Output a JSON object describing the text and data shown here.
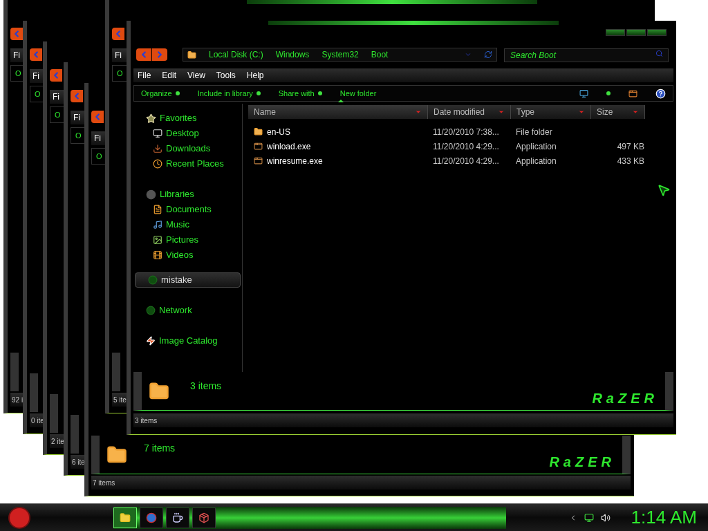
{
  "desktop_windows": [
    {
      "menu_fragment": "Fi",
      "toolbar_fragment": "O",
      "status": "92 i"
    },
    {
      "menu_fragment": "Fi",
      "toolbar_fragment": "O",
      "status": "0 ite"
    },
    {
      "menu_fragment": "Fi",
      "toolbar_fragment": "O",
      "status": "2 ite"
    },
    {
      "menu_fragment": "Fi",
      "toolbar_fragment": "O",
      "status": "6 ite"
    },
    {
      "menu_fragment": "Fi",
      "toolbar_fragment": "O",
      "status": "7 items",
      "details": "7 items",
      "logo": "RaZER"
    },
    {
      "menu_fragment": "Fi",
      "toolbar_fragment": "O",
      "status": "5 ite"
    }
  ],
  "main_window": {
    "address": [
      "Local Disk (C:)",
      "Windows",
      "System32",
      "Boot"
    ],
    "search": {
      "placeholder": "Search Boot"
    },
    "menu": [
      "File",
      "Edit",
      "View",
      "Tools",
      "Help"
    ],
    "toolbar": [
      {
        "label": "Organize",
        "dropdown": true
      },
      {
        "label": "Include in library",
        "dropdown": true
      },
      {
        "label": "Share with",
        "dropdown": true
      },
      {
        "label": "New folder",
        "dropdown": false
      }
    ],
    "columns": [
      {
        "label": "Name",
        "sorted": true
      },
      {
        "label": "Date modified",
        "sorted": false
      },
      {
        "label": "Type",
        "sorted": false
      },
      {
        "label": "Size",
        "sorted": false
      }
    ],
    "rows": [
      {
        "kind": "folder",
        "name": "en-US",
        "date": "11/20/2010 7:38...",
        "type": "File folder"
      },
      {
        "kind": "app",
        "name": "winload.exe",
        "date": "11/20/2010 4:29...",
        "type": "Application",
        "size": "497 KB"
      },
      {
        "kind": "app",
        "name": "winresume.exe",
        "date": "11/20/2010 4:29...",
        "type": "Application",
        "size": "433 KB"
      }
    ],
    "nav": [
      {
        "kind": "star",
        "label": "Favorites",
        "selected": false,
        "children": [
          {
            "kind": "desktop",
            "label": "Desktop",
            "selected": false
          },
          {
            "kind": "download",
            "label": "Downloads",
            "selected": false
          },
          {
            "kind": "recent",
            "label": "Recent Places",
            "selected": false
          }
        ]
      },
      {
        "kind": "library",
        "label": "Libraries",
        "selected": false,
        "children": [
          {
            "kind": "doc",
            "label": "Documents",
            "selected": false
          },
          {
            "kind": "music",
            "label": "Music",
            "selected": false
          },
          {
            "kind": "picture",
            "label": "Pictures",
            "selected": false
          },
          {
            "kind": "video",
            "label": "Videos",
            "selected": false
          }
        ]
      },
      {
        "kind": "orb",
        "label": "mistake",
        "selected": true
      },
      {
        "kind": "orb",
        "label": "Network",
        "selected": false
      },
      {
        "kind": "catalog",
        "label": "Image Catalog",
        "selected": false
      }
    ],
    "details": "3 items",
    "logo": "RaZER",
    "status": "3 items"
  },
  "taskbar": {
    "pinned": [
      {
        "kind": "folder",
        "selected": true
      },
      {
        "kind": "browser",
        "selected": false
      },
      {
        "kind": "java",
        "selected": false
      },
      {
        "kind": "archive",
        "selected": false
      }
    ],
    "clock": "1:14 AM"
  }
}
